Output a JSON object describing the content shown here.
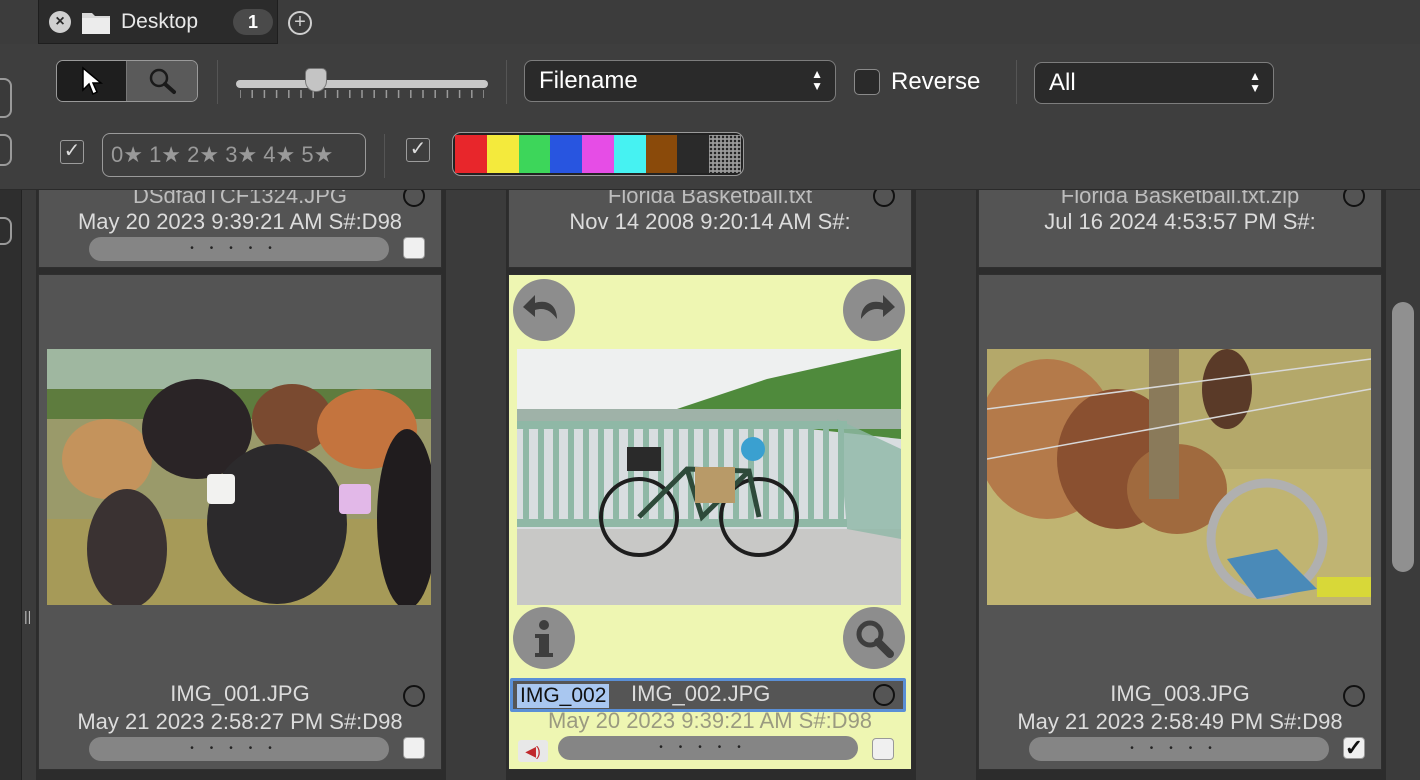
{
  "tab": {
    "title": "Desktop",
    "count": "1"
  },
  "toolbar": {
    "sort_field": "Filename",
    "reverse_label": "Reverse",
    "filter": "All",
    "rating_filter": "0★ 1★ 2★ 3★ 4★ 5★",
    "rating_filter_enabled": true,
    "color_filter_enabled": true,
    "thumbnail_size_fraction": 0.3,
    "color_labels": [
      "#e8262b",
      "#f4ea3c",
      "#3dd65a",
      "#2855e0",
      "#e64de6",
      "#46f2f2",
      "#8a4a0a",
      "#2a2a2a",
      "dotted"
    ],
    "icons": {
      "select_tool": "arrow-pointer-icon",
      "zoom_tool": "magnifier-icon"
    }
  },
  "top_row": [
    {
      "name": "DSdfadTCF1324.JPG",
      "meta": "May 20 2023 9:39:21 AM S#:D98"
    },
    {
      "name": "Florida Basketball.txt",
      "meta": "Nov 14 2008 9:20:14 AM S#:"
    },
    {
      "name": "Florida Basketball.txt.zip",
      "meta": "Jul 16 2024 4:53:57 PM S#:"
    }
  ],
  "cards": [
    {
      "name": "IMG_001.JPG",
      "meta": "May 21 2023 2:58:27 PM S#:D98",
      "checked": false
    },
    {
      "name": "IMG_002.JPG",
      "meta": "May 20 2023 9:39:21 AM S#:D98",
      "checked": false,
      "editing": "IMG_002"
    },
    {
      "name": "IMG_003.JPG",
      "meta": "May 21 2023 2:58:49 PM S#:D98",
      "checked": true
    }
  ],
  "rating_dots": "•••••",
  "checkmark": "✓"
}
